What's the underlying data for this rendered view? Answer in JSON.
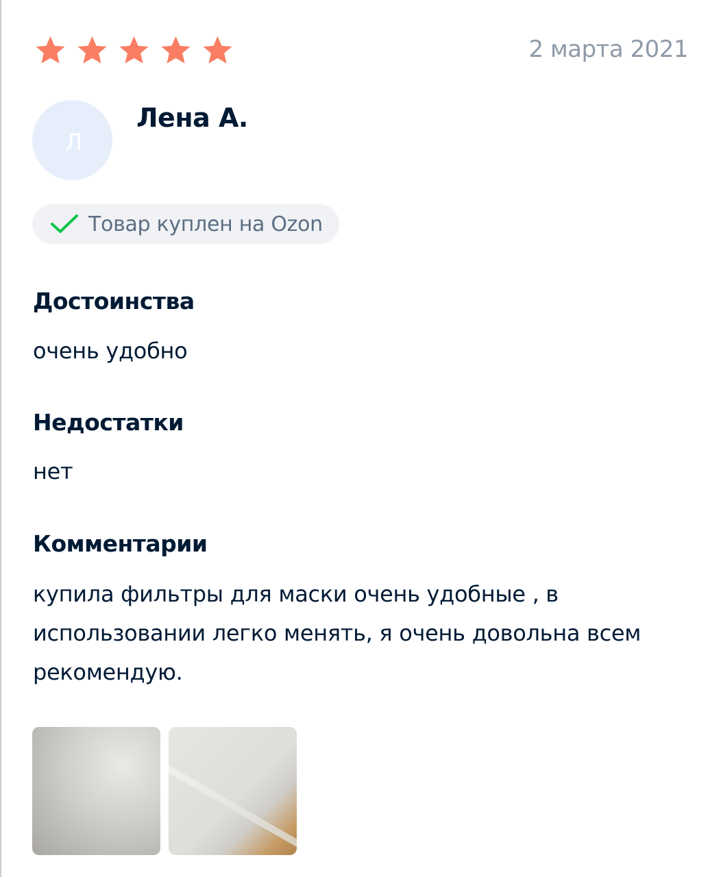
{
  "review": {
    "rating": 5,
    "max_rating": 5,
    "star_color": "#f97e63",
    "date": "2 марта 2021",
    "author": {
      "initial": "Л",
      "name": "Лена А."
    },
    "badge": {
      "icon": "check-icon",
      "label": "Товар куплен на Ozon",
      "check_color": "#10c44c"
    },
    "sections": [
      {
        "title": "Достоинства",
        "text": "очень удобно"
      },
      {
        "title": "Недостатки",
        "text": "нет"
      },
      {
        "title": "Комментарии",
        "text": "купила фильтры для маски очень удобные , в использовании легко менять, я очень довольна всем рекомендую."
      }
    ],
    "photos": [
      "review-photo-1",
      "review-photo-2"
    ]
  }
}
